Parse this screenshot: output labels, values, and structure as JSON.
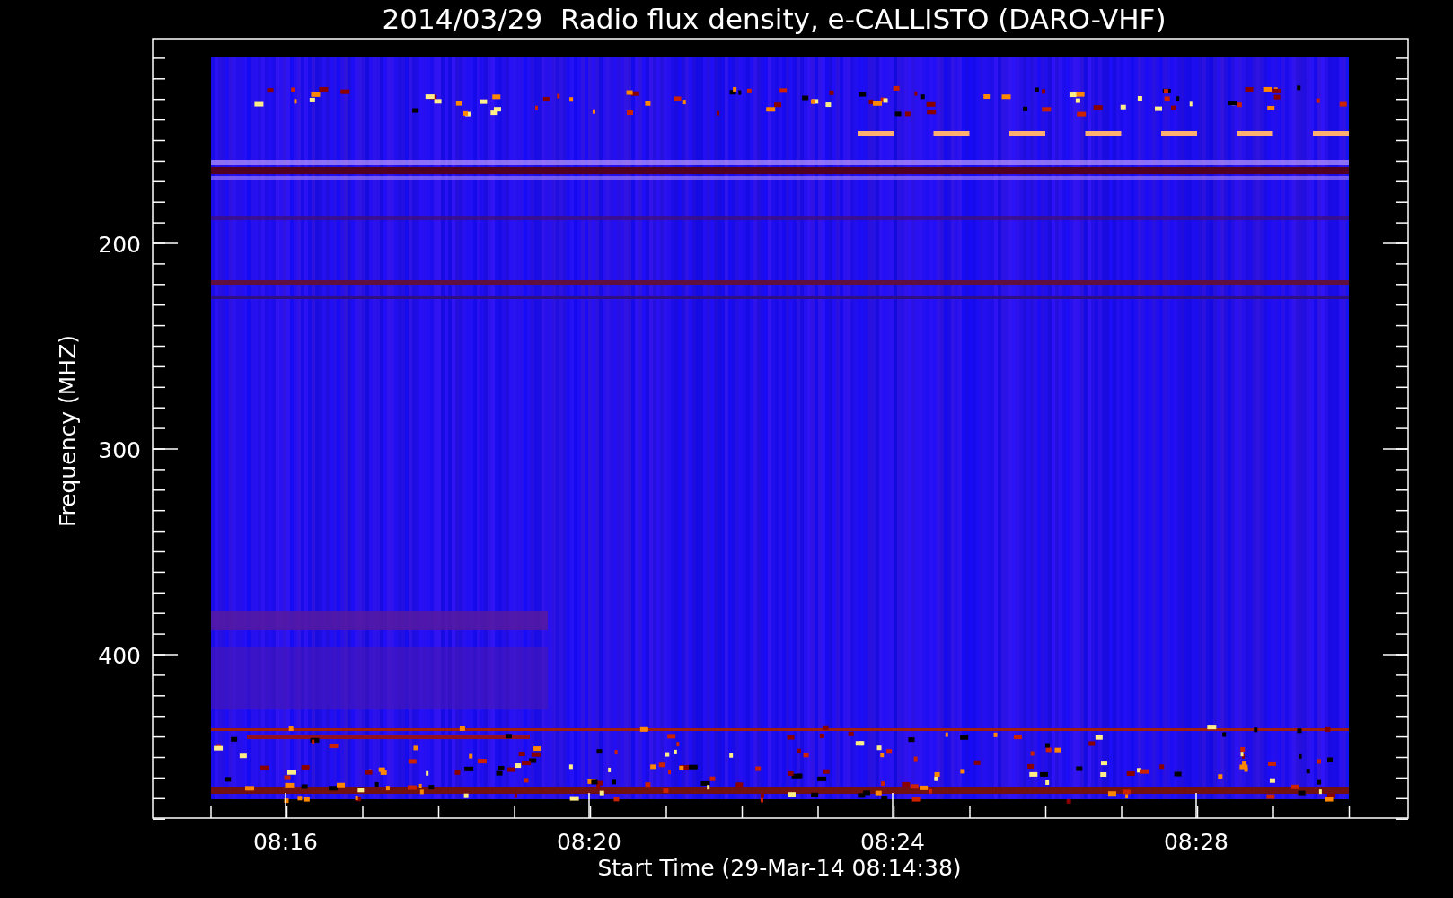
{
  "title": "2014/03/29  Radio flux density, e-CALLISTO (DARO-VHF)",
  "x_axis": {
    "label": "Start Time (29-Mar-14 08:14:38)",
    "ticks": [
      "08:16",
      "08:20",
      "08:24",
      "08:28"
    ]
  },
  "y_axis": {
    "label": "Frequency (MHZ)",
    "ticks": [
      "200",
      "300",
      "400"
    ]
  }
}
